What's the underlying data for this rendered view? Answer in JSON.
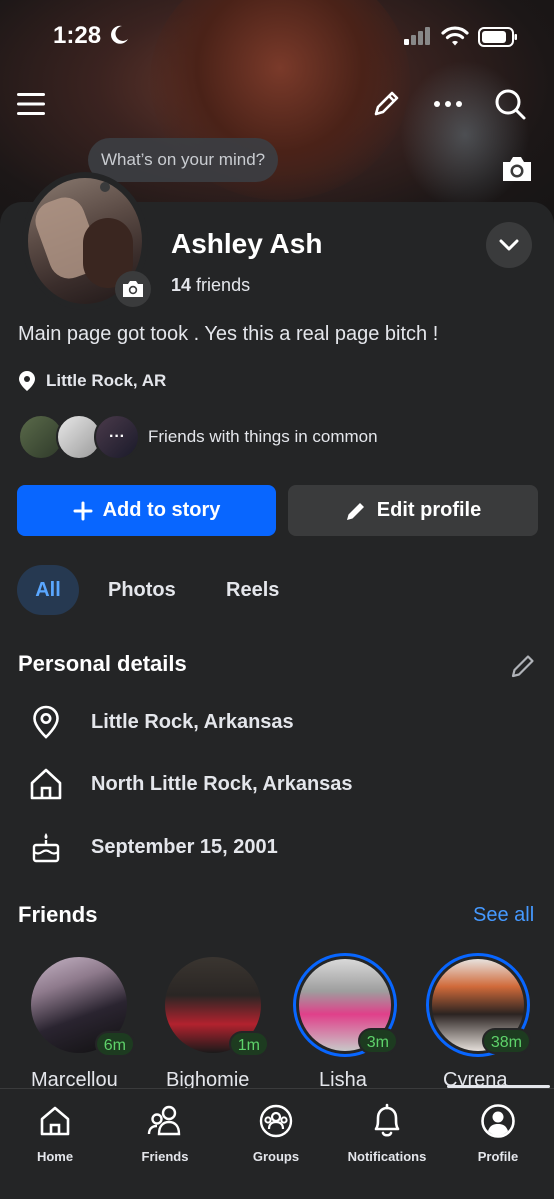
{
  "status_bar": {
    "time": "1:28"
  },
  "cover": {
    "mind_prompt": "What’s on your mind?"
  },
  "profile": {
    "name": "Ashley Ash",
    "friends_count": "14",
    "friends_label": "friends",
    "bio": "Main page got took . Yes this a real page bitch !",
    "location": "Little Rock, AR",
    "mutual_text": "Friends with things in common"
  },
  "actions": {
    "add_story": "Add to story",
    "edit_profile": "Edit profile"
  },
  "tabs": [
    {
      "label": "All",
      "active": true
    },
    {
      "label": "Photos"
    },
    {
      "label": "Reels"
    }
  ],
  "personal_details": {
    "title": "Personal details",
    "items": [
      {
        "icon": "location-pin-icon",
        "text": "Little Rock, Arkansas"
      },
      {
        "icon": "home-icon",
        "text": "North Little Rock, Arkansas"
      },
      {
        "icon": "birthday-cake-icon",
        "text": "September 15, 2001"
      }
    ]
  },
  "friends": {
    "title": "Friends",
    "see_all": "See all",
    "list": [
      {
        "name": "Marcellou",
        "badge": "6m"
      },
      {
        "name": "Bighomie",
        "badge": "1m"
      },
      {
        "name": "Lisha",
        "badge": "3m"
      },
      {
        "name": "Cyrena",
        "badge": "38m"
      }
    ]
  },
  "nav": {
    "home": "Home",
    "friends": "Friends",
    "groups": "Groups",
    "notifications": "Notifications",
    "profile": "Profile"
  },
  "colors": {
    "accent": "#0866ff",
    "link": "#4599ff",
    "background": "#242526",
    "online": "#5ed26a"
  }
}
